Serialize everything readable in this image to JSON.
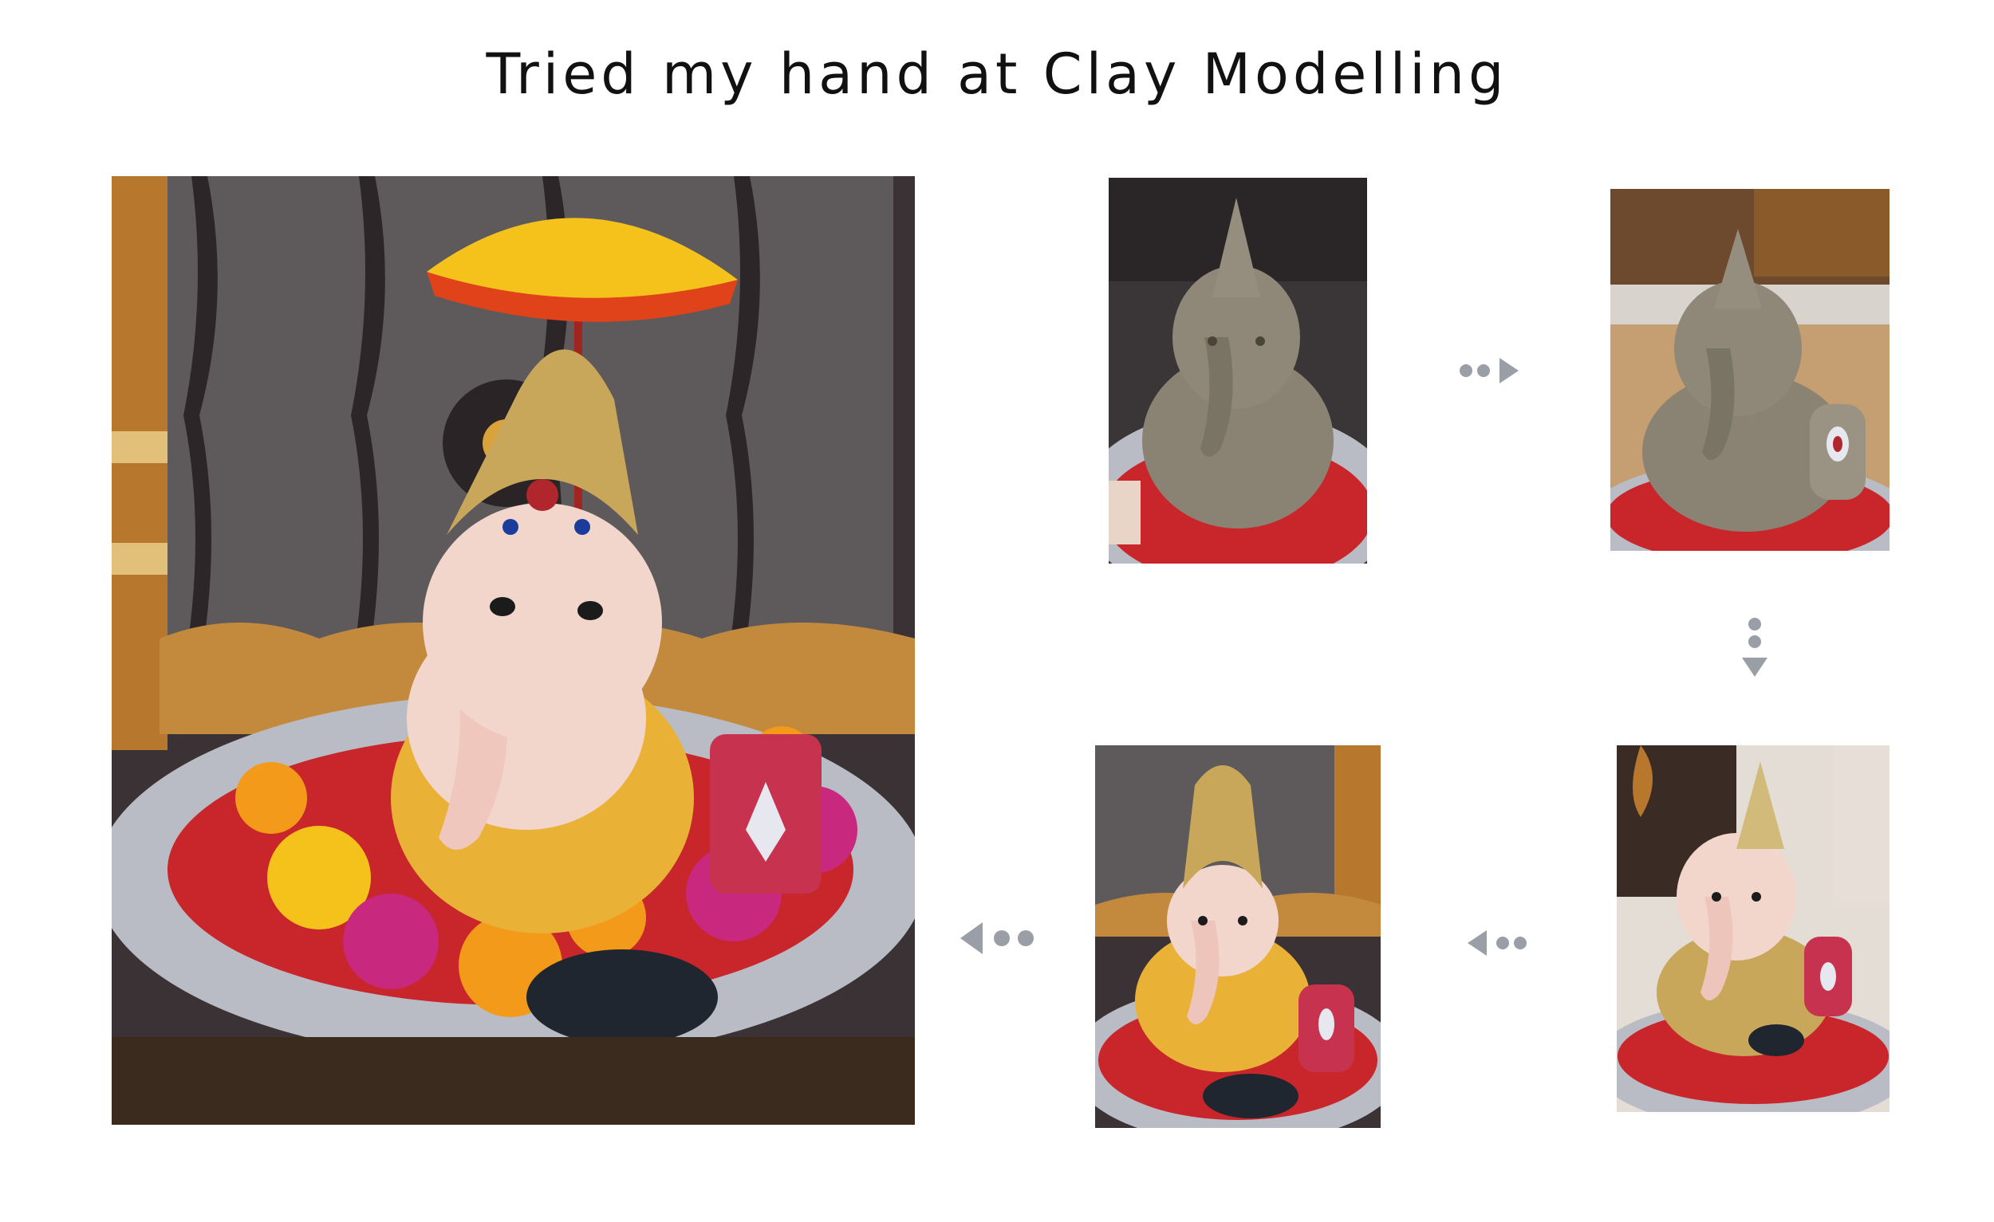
{
  "title": "Tried my hand at Clay Modelling",
  "colors": {
    "arrow": "#9a9ea6",
    "clay": "#8a8373",
    "curtain": "#5e5a5c",
    "plate_red": "#c8262a",
    "plate_silver": "#b9bcc4",
    "marigold": "#f39a1a",
    "magenta": "#c8287e",
    "wood": "#b7782e"
  },
  "photos": [
    {
      "name": "finished-ganesha-decorated"
    },
    {
      "name": "raw-clay-ganesha-step-1"
    },
    {
      "name": "raw-clay-ganesha-detailed-step-2"
    },
    {
      "name": "painted-ganesha-step-3"
    },
    {
      "name": "decorated-ganesha-step-4"
    }
  ],
  "arrows": [
    {
      "from": "step-1",
      "to": "step-2",
      "direction": "right"
    },
    {
      "from": "step-2",
      "to": "step-3",
      "direction": "down"
    },
    {
      "from": "step-3",
      "to": "step-4",
      "direction": "left"
    },
    {
      "from": "step-4",
      "to": "final",
      "direction": "left"
    }
  ]
}
